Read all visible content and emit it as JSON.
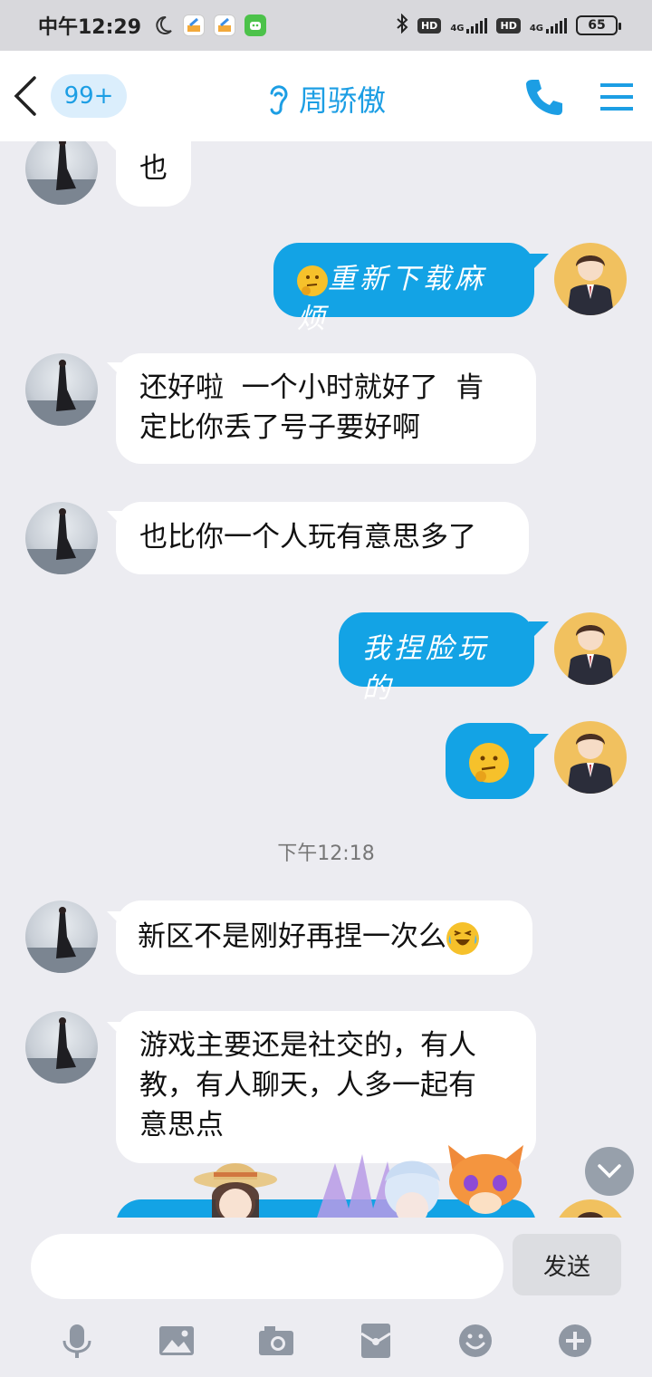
{
  "status_bar": {
    "time": "中午12:29",
    "network1": "4G",
    "network2": "4G",
    "battery": "65"
  },
  "header": {
    "unread_badge": "99+",
    "contact_name": "周骄傲"
  },
  "messages": [
    {
      "from": "her",
      "text": "也"
    },
    {
      "from": "me",
      "text": "重新下载麻烦"
    },
    {
      "from": "her",
      "text_lines": [
        "还好啦  一个小时就好了  肯",
        "定比你丢了号子要好啊"
      ]
    },
    {
      "from": "her",
      "text": "也比你一个人玩有意思多了"
    },
    {
      "from": "me",
      "text": "我捏脸玩的"
    },
    {
      "from": "me",
      "text": ""
    },
    {
      "from": "her",
      "text": "新区不是刚好再捏一次么"
    },
    {
      "from": "her",
      "text_lines": [
        "游戏主要还是社交的，有人",
        "教，有人聊天，人多一起有",
        "意思点"
      ]
    }
  ],
  "timestamp": "下午12:18",
  "input": {
    "placeholder": "",
    "send_label": "发送"
  },
  "colors": {
    "accent": "#1c9ee4",
    "bubble_out": "#13a3e5",
    "background": "#ececf1"
  },
  "toolbar_icons": [
    "microphone-icon",
    "image-icon",
    "camera-icon",
    "red-packet-icon",
    "emoji-icon",
    "plus-icon"
  ]
}
